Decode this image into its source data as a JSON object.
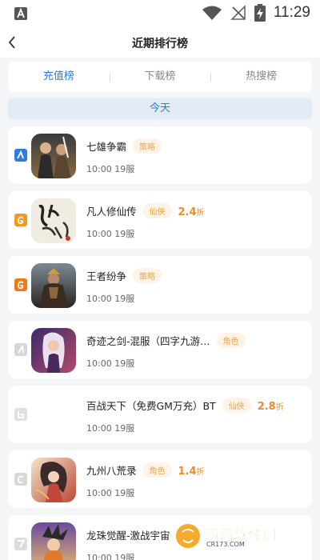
{
  "status_bar": {
    "time": "11:29",
    "icons": [
      "app-notification-icon",
      "wifi-icon",
      "no-signal-icon",
      "battery-charging-icon"
    ]
  },
  "header": {
    "title": "近期排行榜",
    "back_icon": "chevron-left-icon"
  },
  "tabs": [
    {
      "label": "充值榜",
      "active": true
    },
    {
      "label": "下载榜",
      "active": false
    },
    {
      "label": "热搜榜",
      "active": false
    }
  ],
  "day_label": "今天",
  "games": [
    {
      "name": "七雄争霸",
      "tag": "策略",
      "meta": "10:00 19服",
      "discount": "",
      "rank_color": "#2f7be0",
      "thumb": "warriors"
    },
    {
      "name": "凡人修仙传",
      "tag": "仙侠",
      "meta": "10:00 19服",
      "discount": "2.4",
      "rank_color": "#f39a1c",
      "thumb": "calligraphy"
    },
    {
      "name": "王者纷争",
      "tag": "策略",
      "meta": "10:00 19服",
      "discount": "",
      "rank_color": "#f07a1a",
      "thumb": "king"
    },
    {
      "name": "奇迹之剑-混服（四字九游…",
      "tag": "角色",
      "meta": "10:00 19服",
      "discount": "",
      "rank_color": "#d6d6d6",
      "thumb": "sorceress"
    },
    {
      "name": "百战天下（免费GM万充）BT",
      "tag": "仙侠",
      "meta": "10:00 19服",
      "discount": "2.8",
      "rank_color": "#e0e0e0",
      "thumb": "blank"
    },
    {
      "name": "九州八荒录",
      "tag": "角色",
      "meta": "10:00 19服",
      "discount": "1.4",
      "rank_color": "#d8d8d8",
      "thumb": "heroine"
    },
    {
      "name": "龙珠觉醒-激战宇宙",
      "tag": "",
      "meta": "10:00 19服",
      "discount": "",
      "rank_color": "#dcdcdc",
      "thumb": "fighter"
    }
  ],
  "discount_unit": "折",
  "watermark": {
    "text": "西西软件园",
    "sub": "CR173.COM"
  }
}
